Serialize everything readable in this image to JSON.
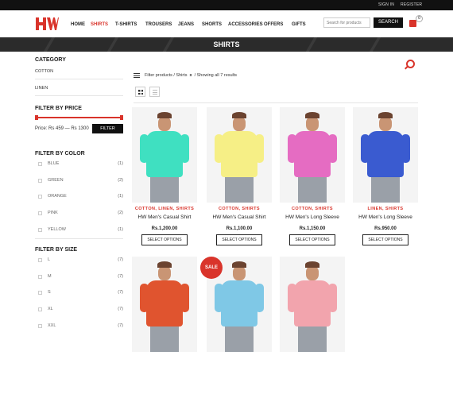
{
  "topbar": {
    "signin": "SIGN IN",
    "register": "REGISTER"
  },
  "header": {
    "logo": "HW",
    "nav": [
      "HOME",
      "SHIRTS",
      "T-SHIRTS",
      "TROUSERS",
      "JEANS",
      "SHORTS",
      "ACCESSORIES",
      "OFFERS",
      "GIFTS"
    ],
    "search_placeholder": "Search for products",
    "search_button": "SEARCH",
    "cart_count": "0"
  },
  "banner": {
    "title": "SHIRTS"
  },
  "sidebar": {
    "category": {
      "title": "CATEGORY",
      "items": [
        "COTTON",
        "LINEN"
      ]
    },
    "price": {
      "title": "FILTER BY PRICE",
      "label": "Price: Rs 459 — Rs 1300",
      "button": "FILTER"
    },
    "color": {
      "title": "FILTER BY COLOR",
      "items": [
        {
          "label": "BLUE",
          "count": "(1)"
        },
        {
          "label": "GREEN",
          "count": "(2)"
        },
        {
          "label": "ORANGE",
          "count": "(1)"
        },
        {
          "label": "PINK",
          "count": "(2)"
        },
        {
          "label": "YELLOW",
          "count": "(1)"
        }
      ]
    },
    "size": {
      "title": "FILTER BY SIZE",
      "items": [
        {
          "label": "L",
          "count": "(7)"
        },
        {
          "label": "M",
          "count": "(7)"
        },
        {
          "label": "S",
          "count": "(7)"
        },
        {
          "label": "XL",
          "count": "(7)"
        },
        {
          "label": "XXL",
          "count": "(7)"
        }
      ]
    }
  },
  "toolbar": {
    "filter_label": "Filter products / Shirts",
    "clear_label": "x",
    "result_count": "/ Showing all 7 results"
  },
  "products": [
    {
      "cats": "COTTON, LINEN, SHIRTS",
      "name": "HW Men's Casual Shirt",
      "price": "Rs.1,200.00",
      "button": "SELECT OPTIONS",
      "shirt_color": "#3fe0c1",
      "sale": ""
    },
    {
      "cats": "COTTON, SHIRTS",
      "name": "HW Men's Casual Shirt",
      "price": "Rs.1,100.00",
      "button": "SELECT OPTIONS",
      "shirt_color": "#f6ef86",
      "sale": ""
    },
    {
      "cats": "COTTON, SHIRTS",
      "name": "HW Men's Long Sleeve",
      "price": "Rs.1,150.00",
      "button": "SELECT OPTIONS",
      "shirt_color": "#e56cc2",
      "sale": ""
    },
    {
      "cats": "LINEN, SHIRTS",
      "name": "HW Men's Long Sleeve",
      "price": "Rs.950.00",
      "button": "SELECT OPTIONS",
      "shirt_color": "#3a5bd0",
      "sale": ""
    },
    {
      "cats": "",
      "name": "",
      "price": "",
      "button": "",
      "shirt_color": "#e0542f",
      "sale": ""
    },
    {
      "cats": "",
      "name": "",
      "price": "",
      "button": "",
      "shirt_color": "#7fc8e6",
      "sale": "SALE"
    },
    {
      "cats": "",
      "name": "",
      "price": "",
      "button": "",
      "shirt_color": "#f2a4ad",
      "sale": ""
    }
  ],
  "colors": {
    "accent": "#d9342b",
    "dark": "#111111",
    "banner": "#2b2b2b"
  }
}
